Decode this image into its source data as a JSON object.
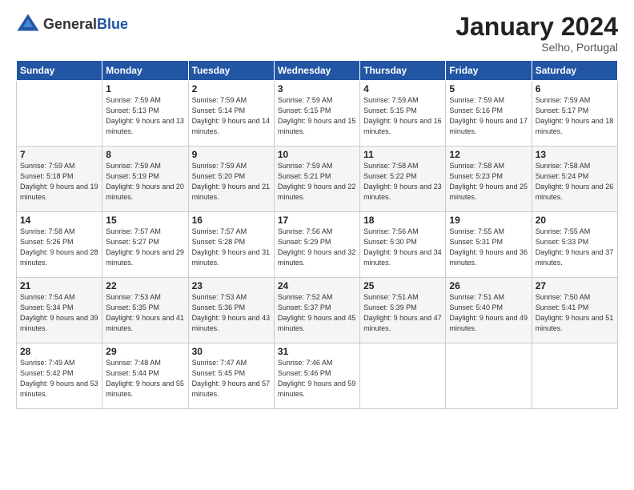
{
  "logo": {
    "general": "General",
    "blue": "Blue"
  },
  "header": {
    "month_title": "January 2024",
    "location": "Selho, Portugal"
  },
  "weekdays": [
    "Sunday",
    "Monday",
    "Tuesday",
    "Wednesday",
    "Thursday",
    "Friday",
    "Saturday"
  ],
  "weeks": [
    [
      {
        "day": "",
        "sunrise": "",
        "sunset": "",
        "daylight": ""
      },
      {
        "day": "1",
        "sunrise": "Sunrise: 7:59 AM",
        "sunset": "Sunset: 5:13 PM",
        "daylight": "Daylight: 9 hours and 13 minutes."
      },
      {
        "day": "2",
        "sunrise": "Sunrise: 7:59 AM",
        "sunset": "Sunset: 5:14 PM",
        "daylight": "Daylight: 9 hours and 14 minutes."
      },
      {
        "day": "3",
        "sunrise": "Sunrise: 7:59 AM",
        "sunset": "Sunset: 5:15 PM",
        "daylight": "Daylight: 9 hours and 15 minutes."
      },
      {
        "day": "4",
        "sunrise": "Sunrise: 7:59 AM",
        "sunset": "Sunset: 5:15 PM",
        "daylight": "Daylight: 9 hours and 16 minutes."
      },
      {
        "day": "5",
        "sunrise": "Sunrise: 7:59 AM",
        "sunset": "Sunset: 5:16 PM",
        "daylight": "Daylight: 9 hours and 17 minutes."
      },
      {
        "day": "6",
        "sunrise": "Sunrise: 7:59 AM",
        "sunset": "Sunset: 5:17 PM",
        "daylight": "Daylight: 9 hours and 18 minutes."
      }
    ],
    [
      {
        "day": "7",
        "sunrise": "Sunrise: 7:59 AM",
        "sunset": "Sunset: 5:18 PM",
        "daylight": "Daylight: 9 hours and 19 minutes."
      },
      {
        "day": "8",
        "sunrise": "Sunrise: 7:59 AM",
        "sunset": "Sunset: 5:19 PM",
        "daylight": "Daylight: 9 hours and 20 minutes."
      },
      {
        "day": "9",
        "sunrise": "Sunrise: 7:59 AM",
        "sunset": "Sunset: 5:20 PM",
        "daylight": "Daylight: 9 hours and 21 minutes."
      },
      {
        "day": "10",
        "sunrise": "Sunrise: 7:59 AM",
        "sunset": "Sunset: 5:21 PM",
        "daylight": "Daylight: 9 hours and 22 minutes."
      },
      {
        "day": "11",
        "sunrise": "Sunrise: 7:58 AM",
        "sunset": "Sunset: 5:22 PM",
        "daylight": "Daylight: 9 hours and 23 minutes."
      },
      {
        "day": "12",
        "sunrise": "Sunrise: 7:58 AM",
        "sunset": "Sunset: 5:23 PM",
        "daylight": "Daylight: 9 hours and 25 minutes."
      },
      {
        "day": "13",
        "sunrise": "Sunrise: 7:58 AM",
        "sunset": "Sunset: 5:24 PM",
        "daylight": "Daylight: 9 hours and 26 minutes."
      }
    ],
    [
      {
        "day": "14",
        "sunrise": "Sunrise: 7:58 AM",
        "sunset": "Sunset: 5:26 PM",
        "daylight": "Daylight: 9 hours and 28 minutes."
      },
      {
        "day": "15",
        "sunrise": "Sunrise: 7:57 AM",
        "sunset": "Sunset: 5:27 PM",
        "daylight": "Daylight: 9 hours and 29 minutes."
      },
      {
        "day": "16",
        "sunrise": "Sunrise: 7:57 AM",
        "sunset": "Sunset: 5:28 PM",
        "daylight": "Daylight: 9 hours and 31 minutes."
      },
      {
        "day": "17",
        "sunrise": "Sunrise: 7:56 AM",
        "sunset": "Sunset: 5:29 PM",
        "daylight": "Daylight: 9 hours and 32 minutes."
      },
      {
        "day": "18",
        "sunrise": "Sunrise: 7:56 AM",
        "sunset": "Sunset: 5:30 PM",
        "daylight": "Daylight: 9 hours and 34 minutes."
      },
      {
        "day": "19",
        "sunrise": "Sunrise: 7:55 AM",
        "sunset": "Sunset: 5:31 PM",
        "daylight": "Daylight: 9 hours and 36 minutes."
      },
      {
        "day": "20",
        "sunrise": "Sunrise: 7:55 AM",
        "sunset": "Sunset: 5:33 PM",
        "daylight": "Daylight: 9 hours and 37 minutes."
      }
    ],
    [
      {
        "day": "21",
        "sunrise": "Sunrise: 7:54 AM",
        "sunset": "Sunset: 5:34 PM",
        "daylight": "Daylight: 9 hours and 39 minutes."
      },
      {
        "day": "22",
        "sunrise": "Sunrise: 7:53 AM",
        "sunset": "Sunset: 5:35 PM",
        "daylight": "Daylight: 9 hours and 41 minutes."
      },
      {
        "day": "23",
        "sunrise": "Sunrise: 7:53 AM",
        "sunset": "Sunset: 5:36 PM",
        "daylight": "Daylight: 9 hours and 43 minutes."
      },
      {
        "day": "24",
        "sunrise": "Sunrise: 7:52 AM",
        "sunset": "Sunset: 5:37 PM",
        "daylight": "Daylight: 9 hours and 45 minutes."
      },
      {
        "day": "25",
        "sunrise": "Sunrise: 7:51 AM",
        "sunset": "Sunset: 5:39 PM",
        "daylight": "Daylight: 9 hours and 47 minutes."
      },
      {
        "day": "26",
        "sunrise": "Sunrise: 7:51 AM",
        "sunset": "Sunset: 5:40 PM",
        "daylight": "Daylight: 9 hours and 49 minutes."
      },
      {
        "day": "27",
        "sunrise": "Sunrise: 7:50 AM",
        "sunset": "Sunset: 5:41 PM",
        "daylight": "Daylight: 9 hours and 51 minutes."
      }
    ],
    [
      {
        "day": "28",
        "sunrise": "Sunrise: 7:49 AM",
        "sunset": "Sunset: 5:42 PM",
        "daylight": "Daylight: 9 hours and 53 minutes."
      },
      {
        "day": "29",
        "sunrise": "Sunrise: 7:48 AM",
        "sunset": "Sunset: 5:44 PM",
        "daylight": "Daylight: 9 hours and 55 minutes."
      },
      {
        "day": "30",
        "sunrise": "Sunrise: 7:47 AM",
        "sunset": "Sunset: 5:45 PM",
        "daylight": "Daylight: 9 hours and 57 minutes."
      },
      {
        "day": "31",
        "sunrise": "Sunrise: 7:46 AM",
        "sunset": "Sunset: 5:46 PM",
        "daylight": "Daylight: 9 hours and 59 minutes."
      },
      {
        "day": "",
        "sunrise": "",
        "sunset": "",
        "daylight": ""
      },
      {
        "day": "",
        "sunrise": "",
        "sunset": "",
        "daylight": ""
      },
      {
        "day": "",
        "sunrise": "",
        "sunset": "",
        "daylight": ""
      }
    ]
  ]
}
